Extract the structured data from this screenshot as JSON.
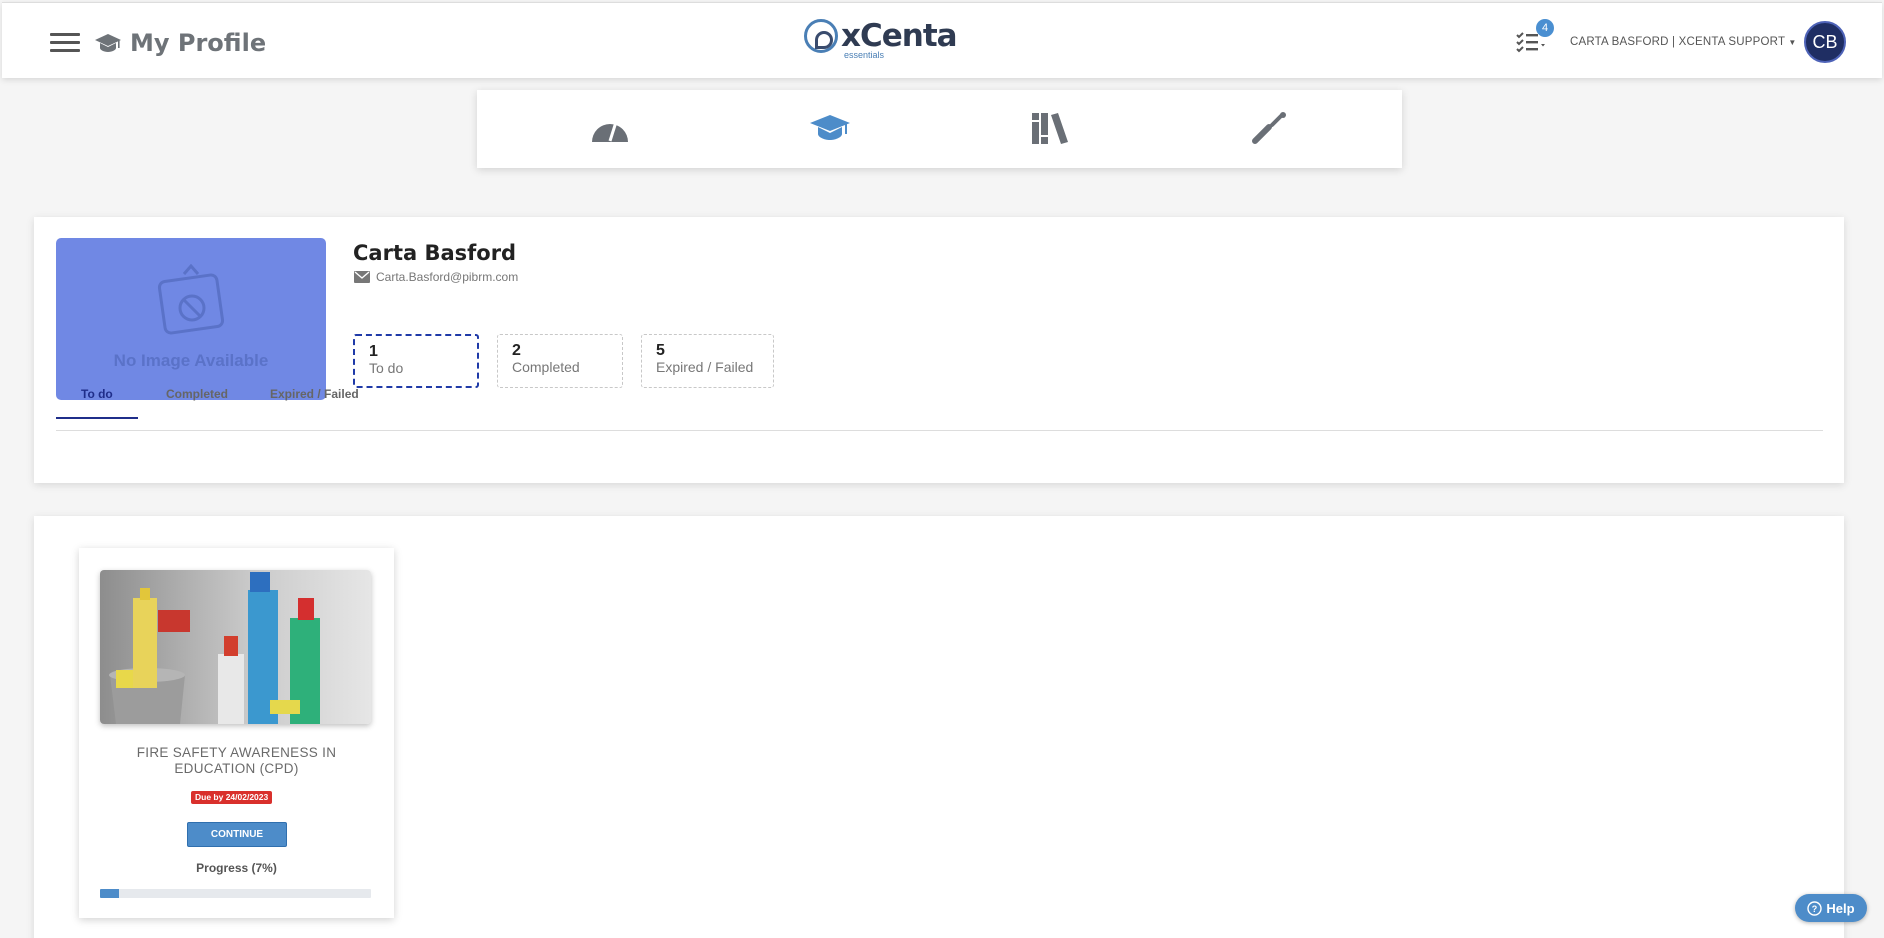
{
  "header": {
    "page_title": "My Profile",
    "logo_text": "xCenta",
    "logo_sub": "essentials",
    "task_count": "4",
    "user_label": "CARTA BASFORD | XCENTA SUPPORT",
    "avatar_initials": "CB"
  },
  "nav_icons": [
    "dashboard-icon",
    "graduation-cap-icon",
    "library-icon",
    "tools-icon"
  ],
  "profile": {
    "no_image_text": "No Image Available",
    "name": "Carta Basford",
    "email": "Carta.Basford@pibrm.com",
    "stats": [
      {
        "count": "1",
        "label": "To do"
      },
      {
        "count": "2",
        "label": "Completed"
      },
      {
        "count": "5",
        "label": "Expired / Failed"
      }
    ],
    "tabs": [
      "To do",
      "Completed",
      "Expired / Failed"
    ],
    "active_tab": "To do"
  },
  "course": {
    "title": "FIRE SAFETY AWARENESS IN EDUCATION (CPD)",
    "due": "Due by 24/02/2023",
    "button_label": "CONTINUE",
    "progress_label": "Progress (7%)",
    "progress_percent": 7
  },
  "help_label": "Help",
  "colors": {
    "accent": "#4d8cc9",
    "active_tab": "#1f2e8a",
    "due_badge": "#d9302c",
    "no_image_bg": "#7088e4"
  }
}
